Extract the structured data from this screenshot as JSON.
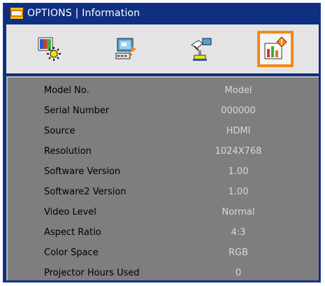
{
  "window": {
    "title": "OPTIONS | Information"
  },
  "tabs": [
    {
      "icon": "image-settings-icon",
      "selected": false
    },
    {
      "icon": "display-settings-icon",
      "selected": false
    },
    {
      "icon": "setup-settings-icon",
      "selected": false
    },
    {
      "icon": "information-icon",
      "selected": true
    }
  ],
  "colors": {
    "frame": "#0e2f82",
    "panel": "#7e7e7e",
    "tab_bar": "#e4e4e4",
    "selection": "#f28a1a",
    "label_text": "#000000",
    "value_text": "#d7d7d7"
  },
  "info": {
    "rows": [
      {
        "label": "Model No.",
        "value": "Model"
      },
      {
        "label": "Serial Number",
        "value": "000000"
      },
      {
        "label": "Source",
        "value": "HDMI"
      },
      {
        "label": "Resolution",
        "value": "1024X768"
      },
      {
        "label": "Software Version",
        "value": "1.00"
      },
      {
        "label": "Software2 Version",
        "value": "1.00"
      },
      {
        "label": "Video Level",
        "value": "Normal"
      },
      {
        "label": "Aspect Ratio",
        "value": "4:3"
      },
      {
        "label": "Color Space",
        "value": "RGB"
      },
      {
        "label": "Projector Hours Used",
        "value": "0"
      }
    ]
  }
}
